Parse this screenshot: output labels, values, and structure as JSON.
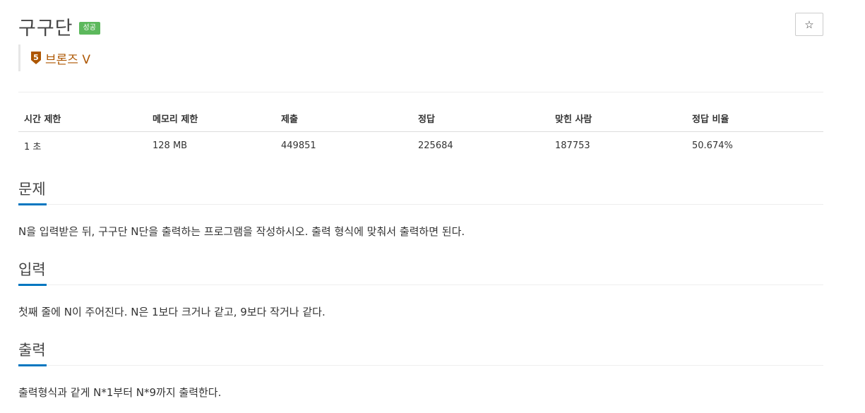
{
  "header": {
    "title": "구구단",
    "result_badge": "성공",
    "favorite_icon": "☆",
    "tier": {
      "level": "5",
      "label": "브론즈 V",
      "color": "#ad5600"
    }
  },
  "stats": {
    "headers": [
      "시간 제한",
      "메모리 제한",
      "제출",
      "정답",
      "맞힌 사람",
      "정답 비율"
    ],
    "values": [
      "1 초",
      "128 MB",
      "449851",
      "225684",
      "187753",
      "50.674%"
    ]
  },
  "sections": {
    "problem": {
      "title": "문제",
      "body": "N을 입력받은 뒤, 구구단 N단을 출력하는 프로그램을 작성하시오. 출력 형식에 맞춰서 출력하면 된다."
    },
    "input": {
      "title": "입력",
      "body": "첫째 줄에 N이 주어진다. N은 1보다 크거나 같고, 9보다 작거나 같다."
    },
    "output": {
      "title": "출력",
      "body": "출력형식과 같게 N*1부터 N*9까지 출력한다."
    }
  },
  "colors": {
    "accent": "#0076c0",
    "success": "#5cb85c",
    "bronze": "#ad5600"
  }
}
